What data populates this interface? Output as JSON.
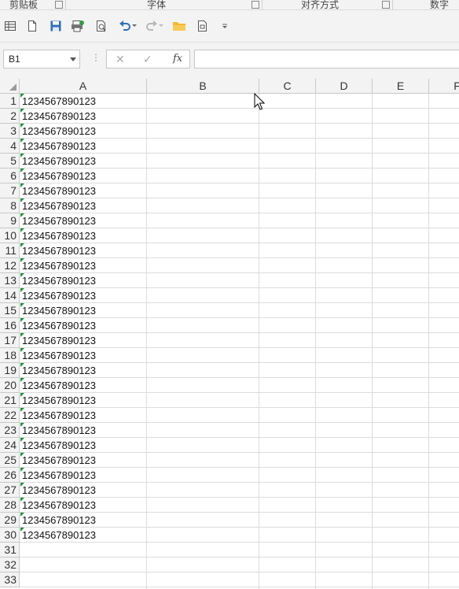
{
  "ribbon_groups": [
    "剪贴板",
    "字体",
    "对齐方式",
    "数字"
  ],
  "quick_access_icons": [
    "table-icon",
    "new-file-icon",
    "save-icon",
    "print-preview-icon",
    "print-icon",
    "undo-icon",
    "redo-icon",
    "open-folder-icon",
    "export-icon",
    "customize-icon"
  ],
  "name_box": {
    "value": "B1"
  },
  "formula_bar": {
    "fx_label": "fx",
    "value": "",
    "cancel_icon": "x-icon",
    "confirm_icon": "check-icon"
  },
  "columns": [
    "A",
    "B",
    "C",
    "D",
    "E",
    "F"
  ],
  "rows": [
    "1",
    "2",
    "3",
    "4",
    "5",
    "6",
    "7",
    "8",
    "9",
    "10",
    "11",
    "12",
    "13",
    "14",
    "15",
    "16",
    "17",
    "18",
    "19",
    "20",
    "21",
    "22",
    "23",
    "24",
    "25",
    "26",
    "27",
    "28",
    "29",
    "30",
    "31",
    "32",
    "33"
  ],
  "column_a_values": [
    "1234567890123",
    "1234567890123",
    "1234567890123",
    "1234567890123",
    "1234567890123",
    "1234567890123",
    "1234567890123",
    "1234567890123",
    "1234567890123",
    "1234567890123",
    "1234567890123",
    "1234567890123",
    "1234567890123",
    "1234567890123",
    "1234567890123",
    "1234567890123",
    "1234567890123",
    "1234567890123",
    "1234567890123",
    "1234567890123",
    "1234567890123",
    "1234567890123",
    "1234567890123",
    "1234567890123",
    "1234567890123",
    "1234567890123",
    "1234567890123",
    "1234567890123",
    "1234567890123",
    "1234567890123"
  ],
  "colors": {
    "error_indicator": "#1a8f3a",
    "chrome": "#f3f3f3",
    "gridline": "#dcdcdc",
    "accent": "#2f6fb3"
  }
}
